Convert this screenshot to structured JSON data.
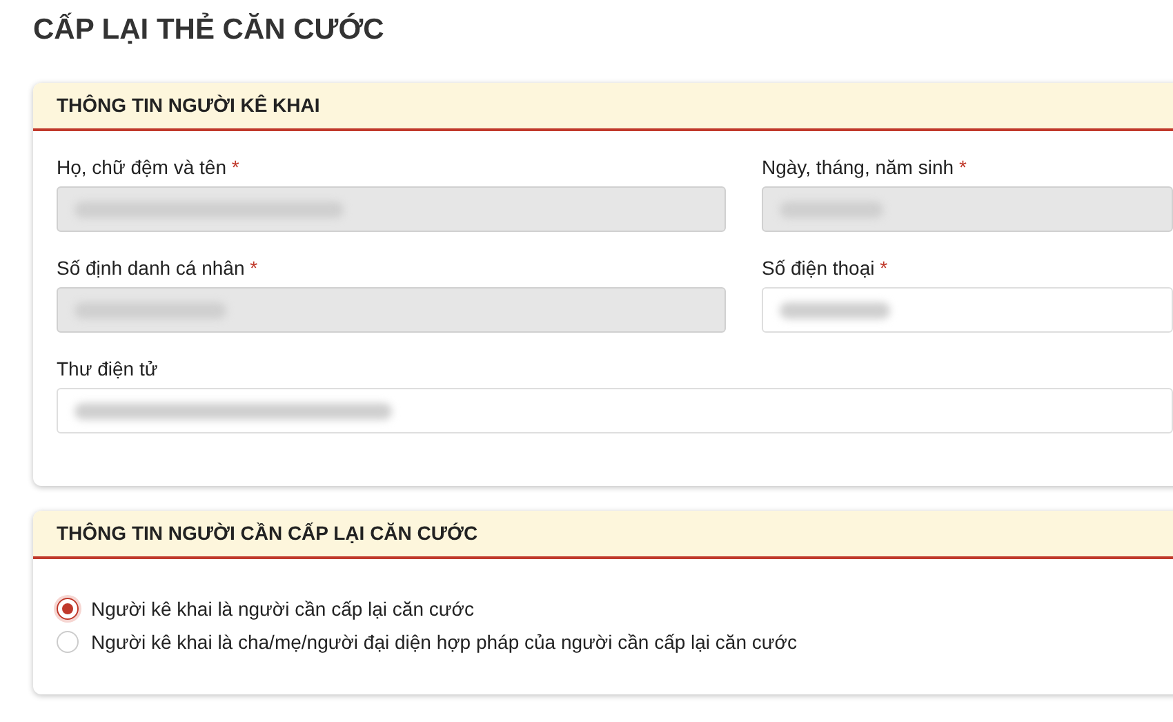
{
  "title": "CẤP LẠI THẺ CĂN CƯỚC",
  "sections": [
    {
      "heading": "THÔNG TIN NGƯỜI KÊ KHAI",
      "kind": "fields",
      "fields": [
        {
          "label": "Họ, chữ đệm và tên",
          "required_mark": "*",
          "disabled": true
        },
        {
          "label": "Ngày, tháng, năm sinh",
          "required_mark": "*",
          "disabled": true
        },
        {
          "label": "Số định danh cá nhân",
          "required_mark": "*",
          "disabled": true
        },
        {
          "label": "Số điện thoại",
          "required_mark": "*",
          "disabled": false
        },
        {
          "label": "Thư điện tử",
          "disabled": false
        }
      ]
    },
    {
      "heading": "THÔNG TIN NGƯỜI CẦN CẤP LẠI CĂN CƯỚC",
      "kind": "radios",
      "options": [
        {
          "label": "Người kê khai là người cần cấp lại căn cước",
          "selected": true
        },
        {
          "label": "Người kê khai là cha/mẹ/người đại diện hợp pháp của người cần cấp lại căn cước",
          "selected": false
        }
      ]
    }
  ]
}
